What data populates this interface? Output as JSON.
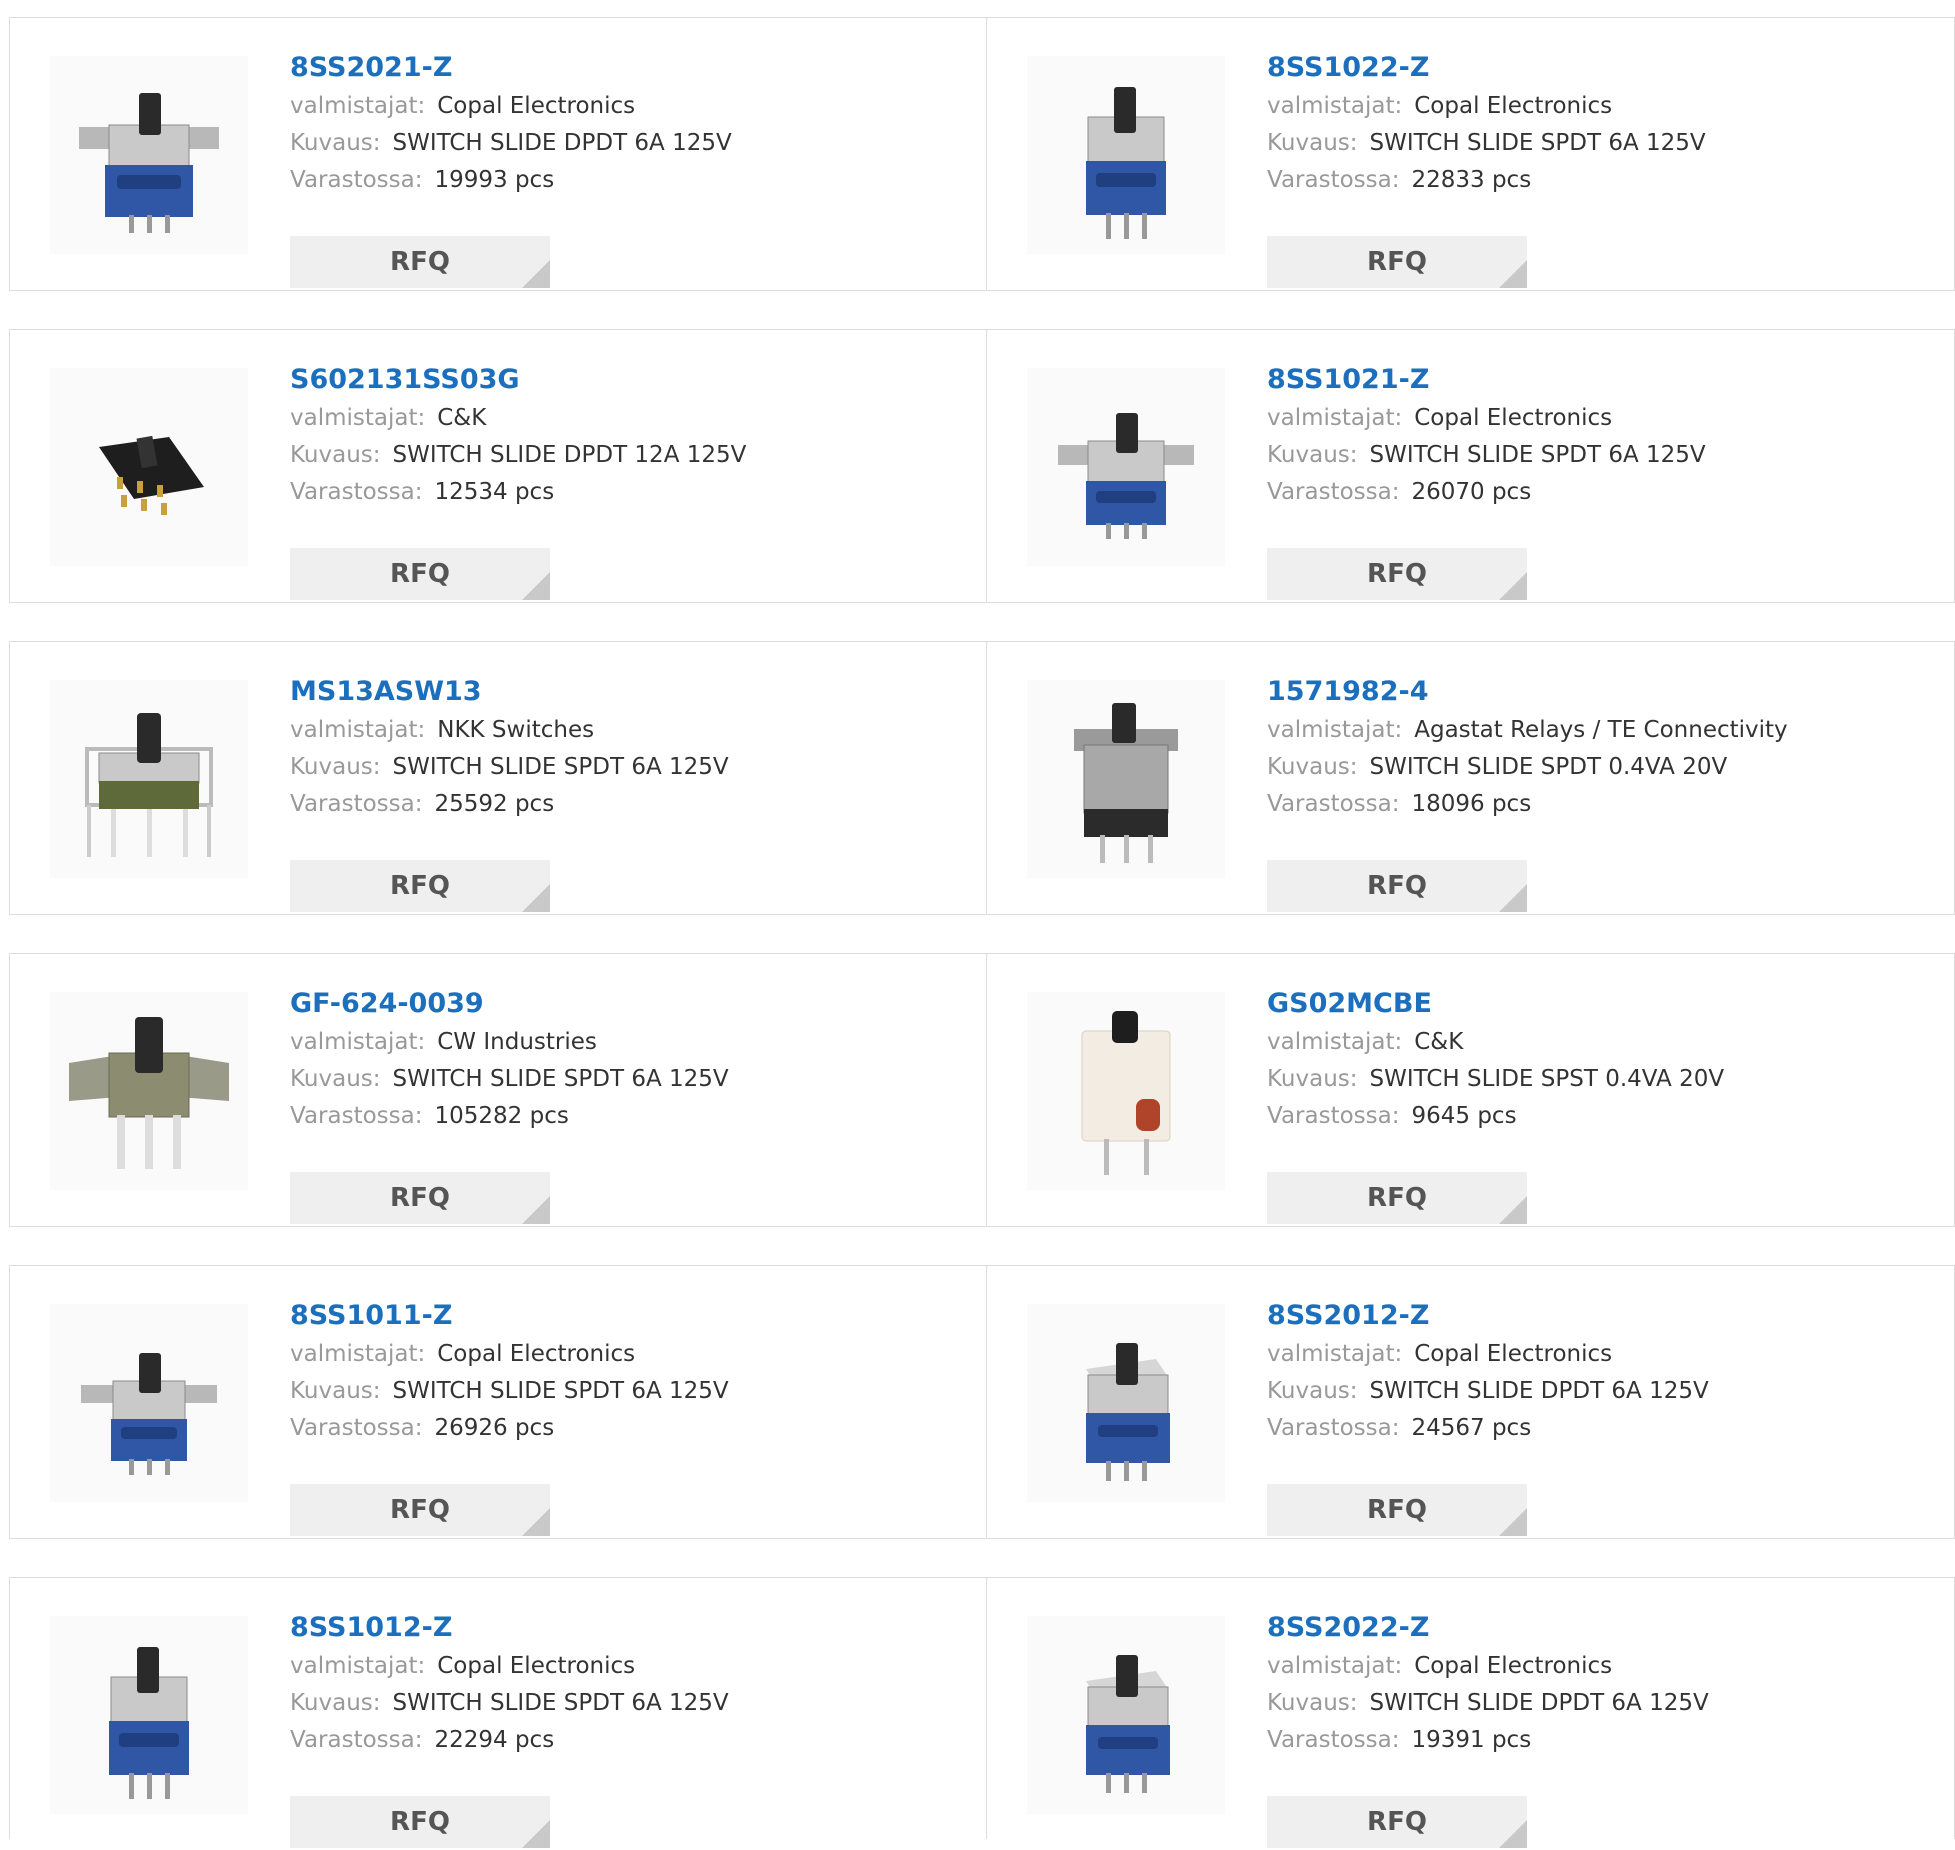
{
  "labels": {
    "manufacturer": "valmistajat:",
    "description": "Kuvaus:",
    "stock": "Varastossa:",
    "rfq": "RFQ"
  },
  "colors": {
    "part_link": "#1c6fbd",
    "label": "#999999",
    "value": "#333333",
    "rfq_bg": "#efefef",
    "border": "#dddddd"
  },
  "products": [
    {
      "part": "8SS2021-Z",
      "manufacturer": "Copal Electronics",
      "description": "SWITCH SLIDE DPDT 6A 125V",
      "stock": "19993 pcs",
      "image": "slide-switch-blue-photo"
    },
    {
      "part": "8SS1022-Z",
      "manufacturer": "Copal Electronics",
      "description": "SWITCH SLIDE SPDT 6A 125V",
      "stock": "22833 pcs",
      "image": "slide-switch-blue-photo"
    },
    {
      "part": "S602131SS03G",
      "manufacturer": "C&K",
      "description": "SWITCH SLIDE DPDT 12A 125V",
      "stock": "12534 pcs",
      "image": "slide-switch-black-photo"
    },
    {
      "part": "8SS1021-Z",
      "manufacturer": "Copal Electronics",
      "description": "SWITCH SLIDE SPDT 6A 125V",
      "stock": "26070 pcs",
      "image": "slide-switch-blue-photo"
    },
    {
      "part": "MS13ASW13",
      "manufacturer": "NKK Switches",
      "description": "SWITCH SLIDE SPDT 6A 125V",
      "stock": "25592 pcs",
      "image": "slide-switch-green-photo"
    },
    {
      "part": "1571982-4",
      "manufacturer": "Agastat Relays / TE Connectivity",
      "description": "SWITCH SLIDE SPDT 0.4VA 20V",
      "stock": "18096 pcs",
      "image": "slide-switch-dark-photo"
    },
    {
      "part": "GF-624-0039",
      "manufacturer": "CW Industries",
      "description": "SWITCH SLIDE SPDT 6A 125V",
      "stock": "105282 pcs",
      "image": "slide-switch-metal-photo"
    },
    {
      "part": "GS02MCBE",
      "manufacturer": "C&K",
      "description": "SWITCH SLIDE SPST 0.4VA 20V",
      "stock": "9645 pcs",
      "image": "slide-switch-white-photo"
    },
    {
      "part": "8SS1011-Z",
      "manufacturer": "Copal Electronics",
      "description": "SWITCH SLIDE SPDT 6A 125V",
      "stock": "26926 pcs",
      "image": "slide-switch-blue-photo"
    },
    {
      "part": "8SS2012-Z",
      "manufacturer": "Copal Electronics",
      "description": "SWITCH SLIDE DPDT 6A 125V",
      "stock": "24567 pcs",
      "image": "slide-switch-blue-photo"
    },
    {
      "part": "8SS1012-Z",
      "manufacturer": "Copal Electronics",
      "description": "SWITCH SLIDE SPDT 6A 125V",
      "stock": "22294 pcs",
      "image": "slide-switch-blue-photo"
    },
    {
      "part": "8SS2022-Z",
      "manufacturer": "Copal Electronics",
      "description": "SWITCH SLIDE DPDT 6A 125V",
      "stock": "19391 pcs",
      "image": "slide-switch-blue-photo"
    }
  ]
}
